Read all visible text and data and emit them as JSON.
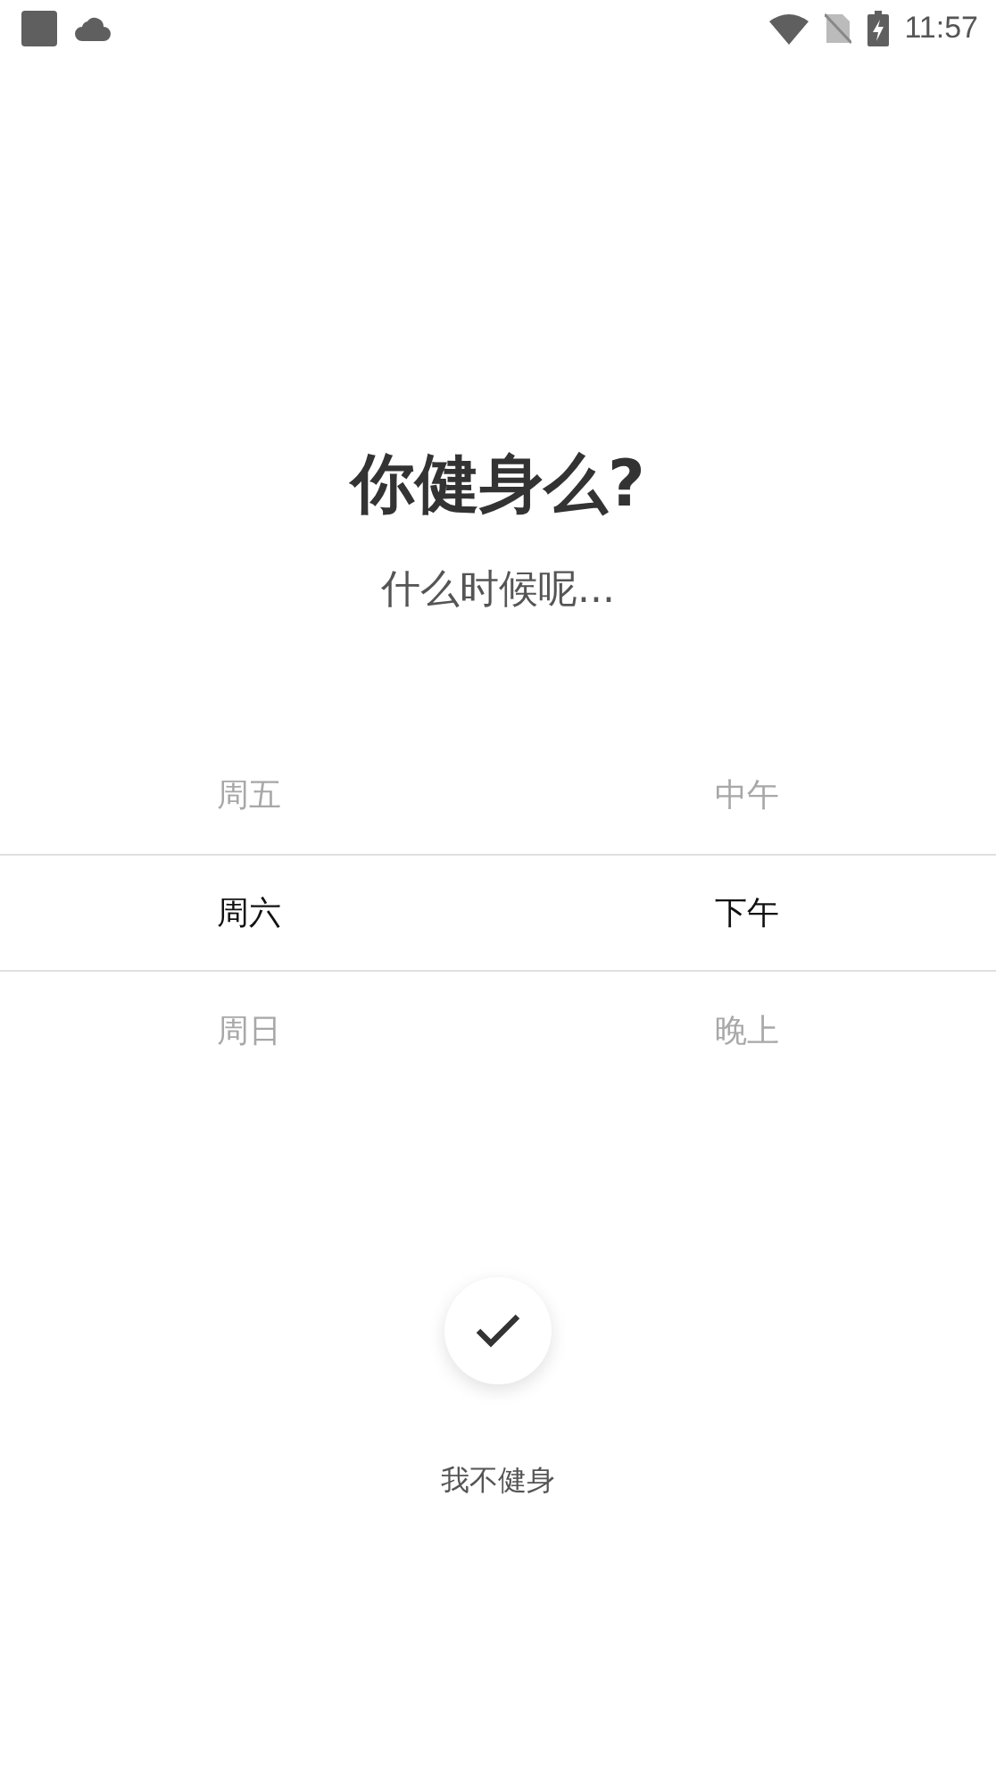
{
  "status_bar": {
    "time": "11:57"
  },
  "title": "你健身么?",
  "subtitle": "什么时候呢...",
  "picker": {
    "columns": [
      {
        "items": [
          {
            "label": "周五",
            "selected": false
          },
          {
            "label": "周六",
            "selected": true
          },
          {
            "label": "周日",
            "selected": false
          }
        ]
      },
      {
        "items": [
          {
            "label": "中午",
            "selected": false
          },
          {
            "label": "下午",
            "selected": true
          },
          {
            "label": "晚上",
            "selected": false
          }
        ]
      }
    ]
  },
  "skip_label": "我不健身"
}
